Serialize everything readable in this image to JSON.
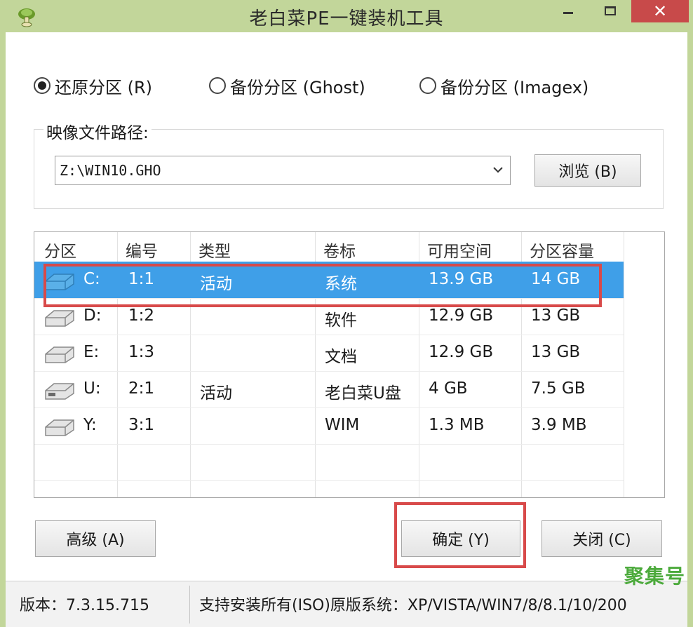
{
  "window": {
    "title": "老白菜PE一键装机工具",
    "close_glyph": "✕"
  },
  "mode": {
    "options": [
      {
        "label": "还原分区 (R)",
        "selected": true
      },
      {
        "label": "备份分区 (Ghost)",
        "selected": false
      },
      {
        "label": "备份分区 (Imagex)",
        "selected": false
      }
    ]
  },
  "image_path": {
    "label": "映像文件路径:",
    "value": "Z:\\WIN10.GHO",
    "browse_label": "浏览 (B)"
  },
  "partitions": {
    "columns": [
      "分区",
      "编号",
      "类型",
      "卷标",
      "可用空间",
      "分区容量"
    ],
    "rows": [
      {
        "drive": "C:",
        "number": "1:1",
        "type": "活动",
        "label": "系统",
        "free": "13.9 GB",
        "capacity": "14 GB",
        "selected": true
      },
      {
        "drive": "D:",
        "number": "1:2",
        "type": "",
        "label": "软件",
        "free": "12.9 GB",
        "capacity": "13 GB",
        "selected": false
      },
      {
        "drive": "E:",
        "number": "1:3",
        "type": "",
        "label": "文档",
        "free": "12.9 GB",
        "capacity": "13 GB",
        "selected": false
      },
      {
        "drive": "U:",
        "number": "2:1",
        "type": "活动",
        "label": "老白菜U盘",
        "free": "4 GB",
        "capacity": "7.5 GB",
        "selected": false
      },
      {
        "drive": "Y:",
        "number": "3:1",
        "type": "",
        "label": "WIM",
        "free": "1.3 MB",
        "capacity": "3.9 MB",
        "selected": false
      }
    ]
  },
  "buttons": {
    "advanced": "高级 (A)",
    "ok": "确定 (Y)",
    "close": "关闭 (C)"
  },
  "status": {
    "version": "版本：7.3.15.715",
    "support": "支持安装所有(ISO)原版系统：XP/VISTA/WIN7/8/8.1/10/200"
  },
  "watermark": "聚集号",
  "colors": {
    "titlebar": "#c2d69a",
    "selection": "#3f9fe8",
    "highlight": "#d84a4a",
    "close_button": "#c84a4a"
  }
}
